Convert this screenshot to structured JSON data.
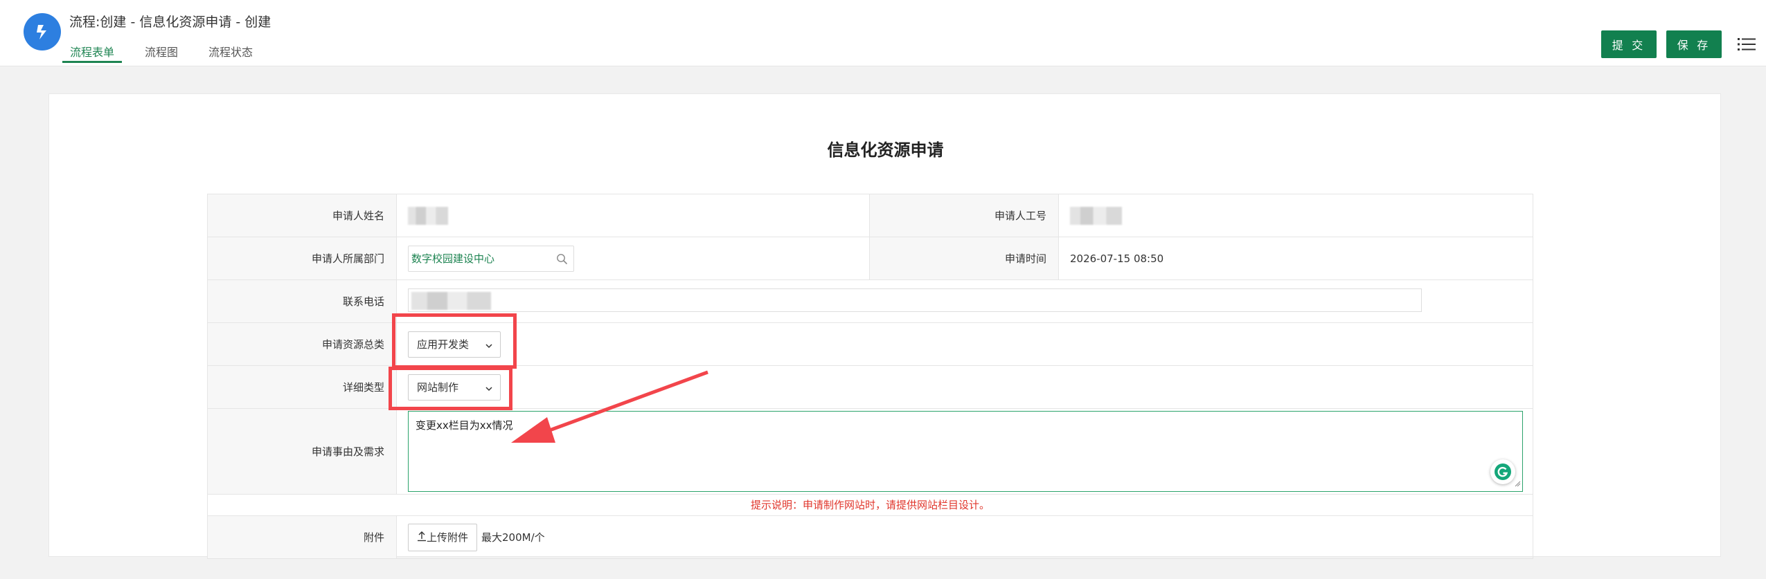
{
  "header": {
    "title": "流程:创建 - 信息化资源申请 - 创建",
    "tabs": [
      {
        "label": "流程表单",
        "active": true
      },
      {
        "label": "流程图",
        "active": false
      },
      {
        "label": "流程状态",
        "active": false
      }
    ],
    "submit_label": "提 交",
    "save_label": "保 存"
  },
  "form": {
    "title": "信息化资源申请",
    "fields": {
      "applicant_name": {
        "label": "申请人姓名"
      },
      "applicant_id": {
        "label": "申请人工号"
      },
      "department": {
        "label": "申请人所属部门",
        "value": "数字校园建设中心"
      },
      "apply_time": {
        "label": "申请时间",
        "value": "2026-07-15 08:50"
      },
      "phone": {
        "label": "联系电话"
      },
      "resource_category": {
        "label": "申请资源总类",
        "value": "应用开发类"
      },
      "detail_type": {
        "label": "详细类型",
        "value": "网站制作"
      },
      "reason": {
        "label": "申请事由及需求",
        "value": "变更xx栏目为xx情况"
      },
      "hint": "提示说明：申请制作网站时，请提供网站栏目设计。",
      "attachment": {
        "label": "附件",
        "button": "上传附件",
        "limit": "最大200M/个"
      }
    }
  },
  "colors": {
    "accent": "#12804f",
    "annotation_red": "#f2454b",
    "hint_red": "#e0352b",
    "logo_blue": "#2d7fe0"
  },
  "icons": [
    "logo-icon",
    "menu-icon",
    "search-icon",
    "chevron-down-icon",
    "upload-icon",
    "grammarly-icon",
    "resize-icon"
  ]
}
